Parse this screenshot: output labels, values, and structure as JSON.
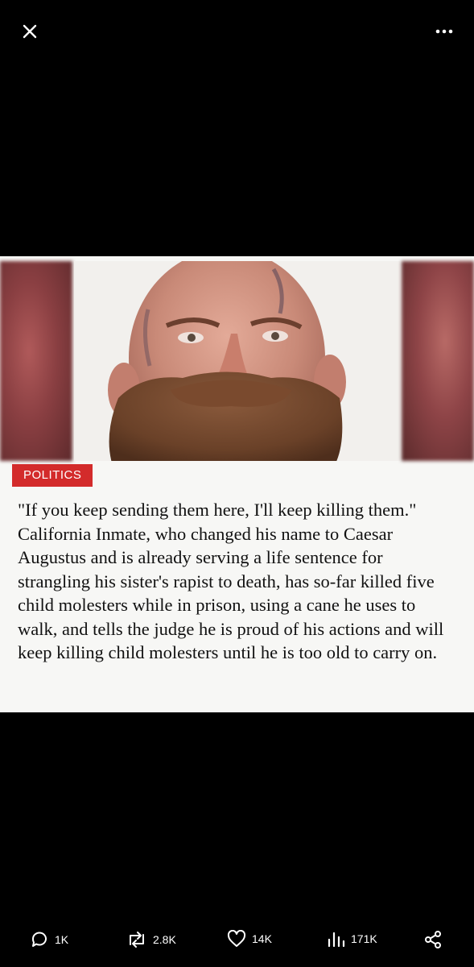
{
  "viewer": {
    "close_icon": "close-icon",
    "more_icon": "more-icon"
  },
  "post_image": {
    "category": "POLITICS",
    "category_color": "#d32b2b",
    "text": "\"If you keep sending them here, I'll keep killing them.\" California Inmate, who changed his name to Caesar Augustus and is already serving a life sentence for strangling his sister's rapist to death, has so-far killed five child molesters while in prison, using a cane he uses to walk, and tells the judge he is proud of his actions and will keep killing child molesters until he is too old to carry on."
  },
  "actions": {
    "replies": "1K",
    "reposts": "2.8K",
    "likes": "14K",
    "views": "171K",
    "share_icon": "share-icon"
  }
}
